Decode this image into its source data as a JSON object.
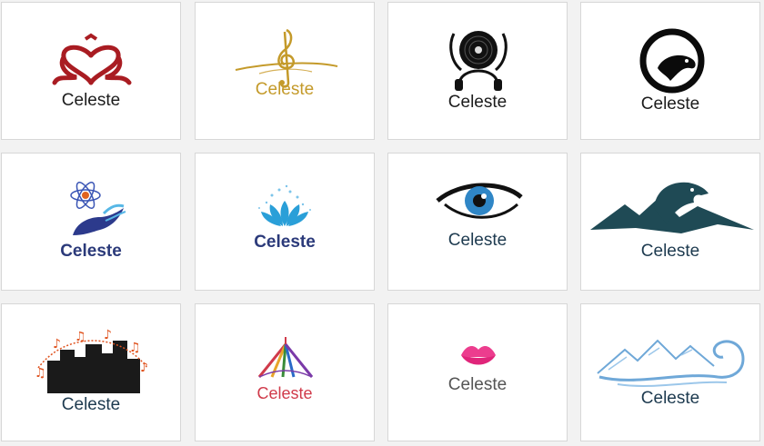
{
  "logos": [
    {
      "name": "Celeste",
      "icon": "heart-ribbon-icon",
      "color": "#1c1c1c",
      "accent": "#a91c22"
    },
    {
      "name": "Celeste",
      "icon": "treble-clef-icon",
      "color": "#c49a2a",
      "accent": "#c49a2a"
    },
    {
      "name": "Celeste",
      "icon": "vinyl-headphones-icon",
      "color": "#1c1c1c",
      "accent": "#111111"
    },
    {
      "name": "Celeste",
      "icon": "eagle-circle-icon",
      "color": "#1c1c1c",
      "accent": "#0b0b0b"
    },
    {
      "name": "Celeste",
      "icon": "atom-hand-icon",
      "color": "#2b3a7a",
      "accent": "#2c3a8c"
    },
    {
      "name": "Celeste",
      "icon": "lotus-icon",
      "color": "#2b3a7a",
      "accent": "#2a9fd8"
    },
    {
      "name": "Celeste",
      "icon": "eye-icon",
      "color": "#1d3a4f",
      "accent": "#2f86c6"
    },
    {
      "name": "Celeste",
      "icon": "eagle-mountain-icon",
      "color": "#1d3a4f",
      "accent": "#1f4a55"
    },
    {
      "name": "Celeste",
      "icon": "city-music-icon",
      "color": "#1d3a4f",
      "accent": "#e0531f"
    },
    {
      "name": "Celeste",
      "icon": "tent-icon",
      "color": "#d03a4a",
      "accent": "#d03a4a"
    },
    {
      "name": "Celeste",
      "icon": "lips-icon",
      "color": "#555555",
      "accent": "#ec3d8e"
    },
    {
      "name": "Celeste",
      "icon": "mountain-wave-icon",
      "color": "#1d3a4f",
      "accent": "#6fa8d8"
    }
  ]
}
